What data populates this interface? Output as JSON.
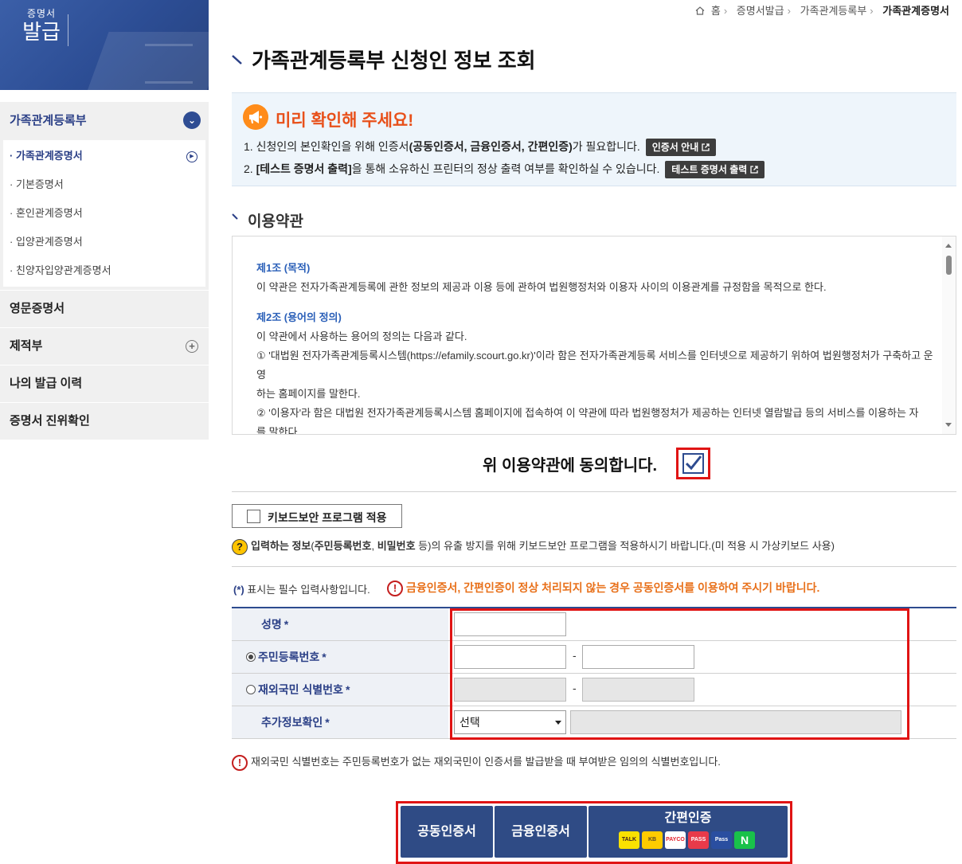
{
  "banner": {
    "line1": "증명서",
    "line2": "발급"
  },
  "sidebar": {
    "groups": [
      {
        "label": "가족관계등록부",
        "items": [
          "· 가족관계증명서",
          "· 기본증명서",
          "· 혼인관계증명서",
          "· 입양관계증명서",
          "· 친양자입양관계증명서"
        ]
      },
      {
        "label": "영문증명서"
      },
      {
        "label": "제적부"
      },
      {
        "label": "나의 발급 이력"
      },
      {
        "label": "증명서 진위확인"
      }
    ]
  },
  "breadcrumb": [
    "홈",
    "증명서발급",
    "가족관계등록부",
    "가족관계증명서"
  ],
  "page_title": "가족관계등록부 신청인 정보 조회",
  "notice": {
    "title": "미리 확인해 주세요!",
    "line1_prefix": "1. 신청인의 본인확인을 위해 인증서",
    "line1_bold": "(공동인증서, 금융인증서, 간편인증)",
    "line1_suffix": "가 필요합니다.",
    "cert_guide_btn": "인증서 안내",
    "line2_prefix": "2. ",
    "line2_bold": "[테스트 증명서 출력]",
    "line2_suffix": "을 통해 소유하신 프린터의 정상 출력 여부를 확인하실 수 있습니다.",
    "test_print_btn": "테스트 증명서 출력"
  },
  "terms": {
    "section_title": "이용약관",
    "art1_title": "제1조 (목적)",
    "art1_body": "이 약관은 전자가족관계등록에 관한 정보의 제공과 이용 등에 관하여 법원행정처와 이용자 사이의 이용관계를 규정함을 목적으로 한다.",
    "art2_title": "제2조 (용어의 정의)",
    "art2_intro": "이 약관에서 사용하는 용어의 정의는 다음과 같다.",
    "art2_item1a": "① '대법원 전자가족관계등록시스템(https://efamily.scourt.go.kr)'이라 함은 전자가족관계등록 서비스를 인터넷으로 제공하기 위하여 법원행정처가 구축하고 운영",
    "art2_item1b": "하는 홈페이지를 말한다.",
    "art2_item2a": "② '이용자'라 함은 대법원 전자가족관계등록시스템 홈페이지에 접속하여 이 약관에 따라 법원행정처가 제공하는 인터넷 열람발급 등의 서비스를 이용하는 자",
    "art2_item2b": "를 말한다.",
    "agree_label": "위 이용약관에 동의합니다."
  },
  "keyboard": {
    "button_label": "키보드보안 프로그램 적용",
    "note_bold1": "입력하는 정보",
    "note_mid1": "(",
    "note_bold2": "주민등록번호",
    "note_mid2": ", ",
    "note_bold3": "비밀번호",
    "note_rest": " 등)의 유출 방지를 위해 키보드보안 프로그램을 적용하시기 바랍니다.(미 적용 시 가상키보드 사용)"
  },
  "form": {
    "required_note_star": "(*)",
    "required_note_text": " 표시는 필수 입력사항입니다.",
    "warning": "금융인증서, 간편인증이 정상 처리되지 않는 경우 공동인증서를 이용하여 주시기 바랍니다.",
    "rows": {
      "name": "성명",
      "rrn": "주민등록번호",
      "foreign": "재외국민 식별번호",
      "extra": "추가정보확인"
    },
    "star": "*",
    "dash": "-",
    "select_value": "선택",
    "foreign_note": "재외국민 식별번호는 주민등록번호가 없는 재외국민이 인증서를 발급받을 때 부여받은 임의의 식별번호입니다."
  },
  "auth": {
    "joint": "공동인증서",
    "financial": "금융인증서",
    "simple": "간편인증",
    "logos": [
      "TALK",
      "KB",
      "PAYCO",
      "PASS",
      "Pass",
      "N"
    ]
  },
  "colors": {
    "brand": "#2f4b85",
    "alert": "#e01414",
    "notice_title": "#e8501a",
    "warning": "#e8701a"
  }
}
